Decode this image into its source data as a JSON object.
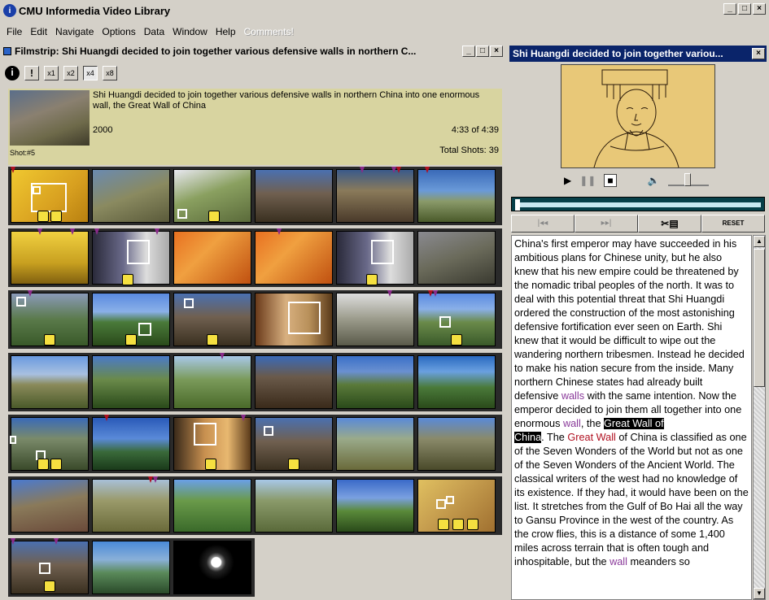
{
  "app": {
    "title": "CMU Informedia Video Library",
    "logo_text": "i"
  },
  "menu": {
    "items": [
      "File",
      "Edit",
      "Navigate",
      "Options",
      "Data",
      "Window",
      "Help"
    ],
    "disabled_item": "Comments!"
  },
  "filmstrip": {
    "title": "Filmstrip: Shi Huangdi decided to join together various defensive walls in northern C...",
    "toolbar": {
      "zoom1": "x1",
      "zoom2": "x2",
      "zoom4": "x4",
      "zoom8": "x8"
    },
    "shot_label": "Shot:#5",
    "description": "Shi Huangdi decided to join together various defensive walls in northern China into one enormous wall, the Great Wall of China",
    "year": "2000",
    "time": "4:33 of 4:39",
    "total_shots": "Total Shots: 39"
  },
  "video": {
    "title": "Shi Huangdi decided to join together variou...",
    "nav": {
      "reset": "RESET"
    }
  },
  "transcript": {
    "part1": "China's first emperor may have succeeded in his ambitious plans for Chinese unity, but he also knew that his new empire could be threatened by the nomadic tribal peoples of the north.  It was to deal with this potential threat that Shi Huangdi ordered the construction of the most astonishing defensive fortification ever seen on Earth.  Shi knew that it would be difficult to wipe out the wandering northern tribesmen. Instead he decided to make his nation secure from the inside.  Many northern Chinese states had already built defensive ",
    "kw_walls": "walls",
    "part2": " with the same intention.  Now the emperor decided to join them all together into one enormous ",
    "kw_wall": "wall",
    "part3": ", the ",
    "hl_great_wall_of": "Great Wall of",
    "hl_china": "China",
    "part4": ".  The ",
    "kw_great_wall": "Great Wall",
    "part5": " of China is classified as one of the Seven Wonders of the World but not as one of the Seven Wonders of the Ancient World.  The classical writers of the west had no knowledge of its existence. If they had, it would have been on the list.  It stretches from the Gulf of Bo Hai all the way to Gansu Province in the west of the country.  As the crow flies, this is a distance of some 1,400 miles across terrain that is often tough and inhospitable, but the ",
    "kw_wall2": "wall",
    "part6": " meanders so"
  }
}
